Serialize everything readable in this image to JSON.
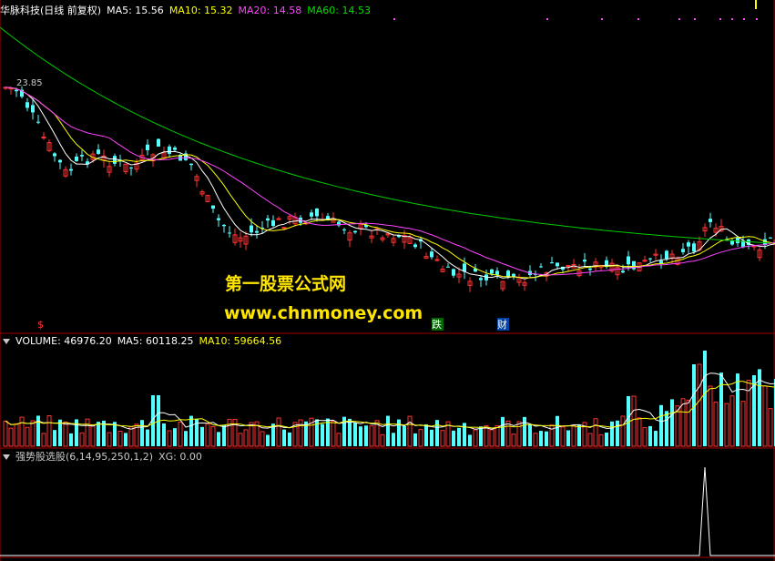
{
  "price_panel": {
    "title": "华脉科技(日线 前复权)",
    "ma5": "MA5: 15.56",
    "ma10": "MA10: 15.32",
    "ma20": "MA20: 14.58",
    "ma60": "MA60: 14.53",
    "high_label": "23.85",
    "markers": {
      "dollar": "$",
      "die": "跌",
      "cai": "财"
    },
    "colors": {
      "ma5": "#ffffff",
      "ma10": "#ffff00",
      "ma20": "#ff44ff",
      "ma60": "#00cc00",
      "up": "#ff3232",
      "down": "#54ffff"
    }
  },
  "volume_panel": {
    "volume": "VOLUME: 46976.20",
    "ma5": "MA5: 60118.25",
    "ma10": "MA10: 59664.56"
  },
  "indicator_panel": {
    "name": "强势股选股(6,14,95,250,1,2)",
    "xg": "XG: 0.00"
  },
  "watermark": {
    "line1": "第一股票公式网",
    "line2": "www.chnmoney.com"
  },
  "chart_data": [
    {
      "type": "candlestick",
      "title": "华脉科技(日线 前复权)",
      "series": [
        {
          "name": "MA5",
          "last": 15.56
        },
        {
          "name": "MA10",
          "last": 15.32
        },
        {
          "name": "MA20",
          "last": 14.58
        },
        {
          "name": "MA60",
          "last": 14.53
        }
      ],
      "annotations": [
        "23.85"
      ]
    },
    {
      "type": "bar",
      "title": "VOLUME",
      "series": [
        {
          "name": "VOLUME",
          "last": 46976.2
        },
        {
          "name": "MA5",
          "last": 60118.25
        },
        {
          "name": "MA10",
          "last": 59664.56
        }
      ]
    },
    {
      "type": "line",
      "title": "强势股选股(6,14,95,250,1,2)",
      "series": [
        {
          "name": "XG",
          "last": 0.0
        }
      ]
    }
  ]
}
